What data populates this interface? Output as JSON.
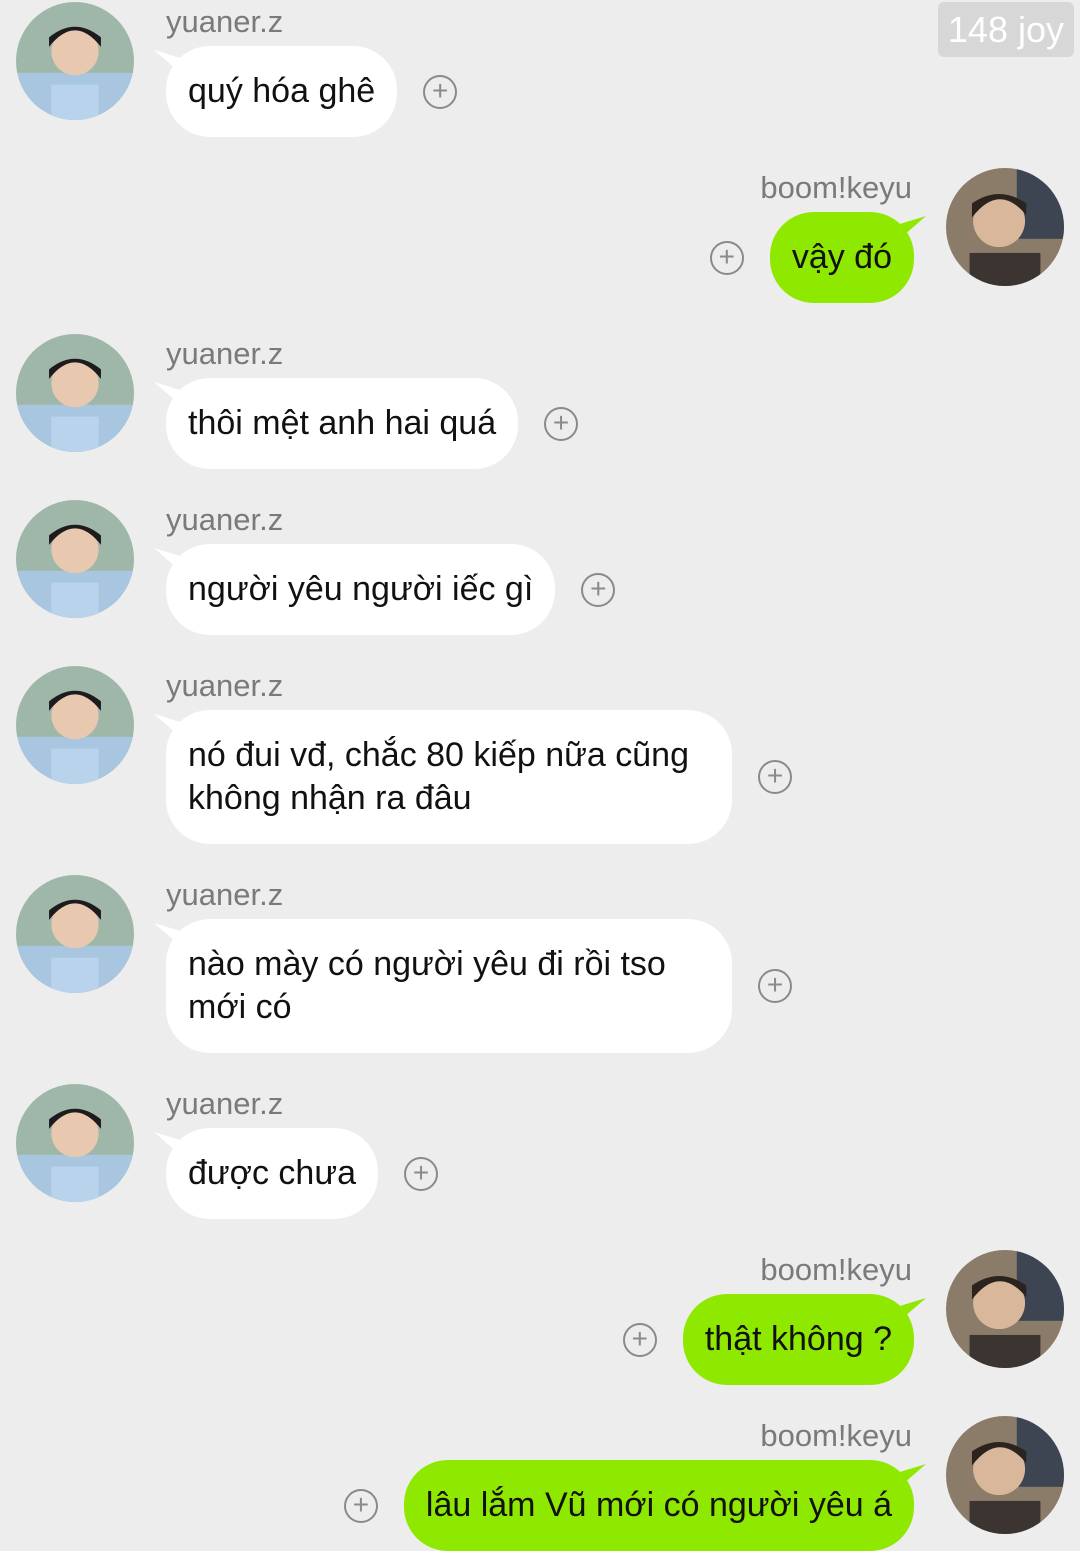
{
  "header": {
    "badge": "148 joy"
  },
  "messages": [
    {
      "sender": "yuaner.z",
      "side": "in",
      "text": "quý hóa ghê"
    },
    {
      "sender": "boom!keyu",
      "side": "out",
      "text": "vậy đó"
    },
    {
      "sender": "yuaner.z",
      "side": "in",
      "text": "thôi mệt anh hai quá"
    },
    {
      "sender": "yuaner.z",
      "side": "in",
      "text": "người yêu người iếc gì"
    },
    {
      "sender": "yuaner.z",
      "side": "in",
      "text": "nó đui vđ, chắc 80 kiếp nữa cũng không nhận ra đâu"
    },
    {
      "sender": "yuaner.z",
      "side": "in",
      "text": "nào mày có người yêu đi rồi tso mới có"
    },
    {
      "sender": "yuaner.z",
      "side": "in",
      "text": "được chưa"
    },
    {
      "sender": "boom!keyu",
      "side": "out",
      "text": "thật không ?"
    },
    {
      "sender": "boom!keyu",
      "side": "out",
      "text": "lâu lắm Vũ mới có người yêu á"
    }
  ],
  "icons": {
    "react": "plus-circle-icon",
    "avatar_in": "avatar-yuaner",
    "avatar_out": "avatar-boomkeyu"
  },
  "colors": {
    "background": "#ededed",
    "incoming_bubble": "#ffffff",
    "outgoing_bubble": "#8ee800",
    "name_text": "#7a7a7a"
  }
}
